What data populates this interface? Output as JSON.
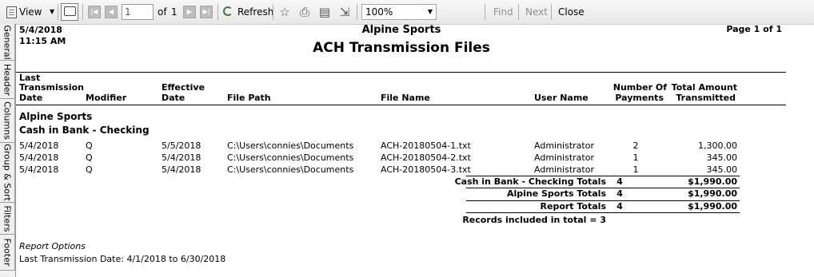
{
  "toolbar": {
    "view_label": "View",
    "page_value": "1",
    "of_label": "of",
    "total_pages": "1",
    "refresh_label": "Refresh",
    "zoom_value": "100%",
    "find_label": "Find",
    "next_label": "Next",
    "close_label": "Close"
  },
  "side_tabs": [
    "General",
    "Header",
    "Columns",
    "Group & Sort",
    "Filters",
    "Footer"
  ],
  "report": {
    "date": "5/4/2018",
    "time": "11:15 AM",
    "company": "Alpine Sports",
    "title": "ACH Transmission Files",
    "page_info": "Page 1 of 1",
    "columns": {
      "last_trans_1": "Last",
      "last_trans_2": "Transmission",
      "last_trans_3": "Date",
      "modifier": "Modifier",
      "effective_1": "Effective",
      "effective_2": "Date",
      "file_path": "File Path",
      "file_name": "File Name",
      "user_name": "User Name",
      "num_payments_1": "Number Of",
      "num_payments_2": "Payments",
      "total_amount_1": "Total Amount",
      "total_amount_2": "Transmitted"
    },
    "group1": "Alpine Sports",
    "group2": "Cash in Bank - Checking",
    "rows": [
      {
        "last": "5/4/2018",
        "modifier": "Q",
        "effective": "5/5/2018",
        "path": "C:\\Users\\connies\\Documents",
        "name": "ACH-20180504-1.txt",
        "user": "Administrator",
        "payments": "2",
        "amount": "1,300.00"
      },
      {
        "last": "5/4/2018",
        "modifier": "Q",
        "effective": "5/4/2018",
        "path": "C:\\Users\\connies\\Documents",
        "name": "ACH-20180504-2.txt",
        "user": "Administrator",
        "payments": "1",
        "amount": "345.00"
      },
      {
        "last": "5/4/2018",
        "modifier": "Q",
        "effective": "5/4/2018",
        "path": "C:\\Users\\connies\\Documents",
        "name": "ACH-20180504-3.txt",
        "user": "Administrator",
        "payments": "1",
        "amount": "345.00"
      }
    ],
    "totals": [
      {
        "label": "Cash in Bank - Checking Totals",
        "count": "4",
        "amount": "$1,990.00"
      },
      {
        "label": "Alpine Sports Totals",
        "count": "4",
        "amount": "$1,990.00"
      },
      {
        "label": "Report Totals",
        "count": "4",
        "amount": "$1,990.00"
      }
    ],
    "records_included": "Records included in total = 3",
    "options_heading": "Report Options",
    "options_line": "Last Transmission Date: 4/1/2018 to 6/30/2018"
  }
}
